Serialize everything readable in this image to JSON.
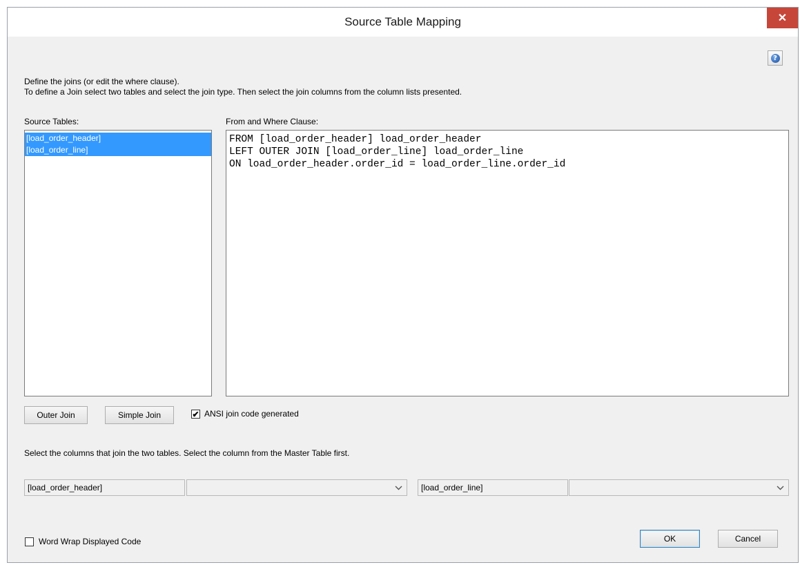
{
  "window": {
    "title": "Source Table Mapping",
    "close_glyph": "✕",
    "help_glyph": "?"
  },
  "instructions": {
    "line1": "Define the joins (or edit the where clause).",
    "line2": "To define a Join select two tables and select the join type. Then select the join columns from the column lists presented."
  },
  "source_tables": {
    "label": "Source Tables:",
    "items": [
      "[load_order_header]",
      "[load_order_line]"
    ]
  },
  "clause": {
    "label": "From and Where Clause:",
    "code": "FROM [load_order_header] load_order_header\nLEFT OUTER JOIN [load_order_line] load_order_line\nON load_order_header.order_id = load_order_line.order_id"
  },
  "join_buttons": {
    "outer_join": "Outer Join",
    "simple_join": "Simple Join"
  },
  "ansi_checkbox": {
    "label": "ANSI join code generated",
    "checked": true,
    "check_glyph": "✔"
  },
  "columns_section": {
    "instruction": "Select the columns that join the two tables. Select the column from the Master Table first.",
    "left_table": "[load_order_header]",
    "left_selected": "",
    "right_table": "[load_order_line]",
    "right_selected": ""
  },
  "word_wrap": {
    "label": "Word Wrap Displayed Code",
    "checked": false
  },
  "footer": {
    "ok": "OK",
    "cancel": "Cancel"
  },
  "colors": {
    "selection": "#3399ff",
    "close_button": "#c7463a",
    "dialog_background": "#f0f0f0"
  }
}
